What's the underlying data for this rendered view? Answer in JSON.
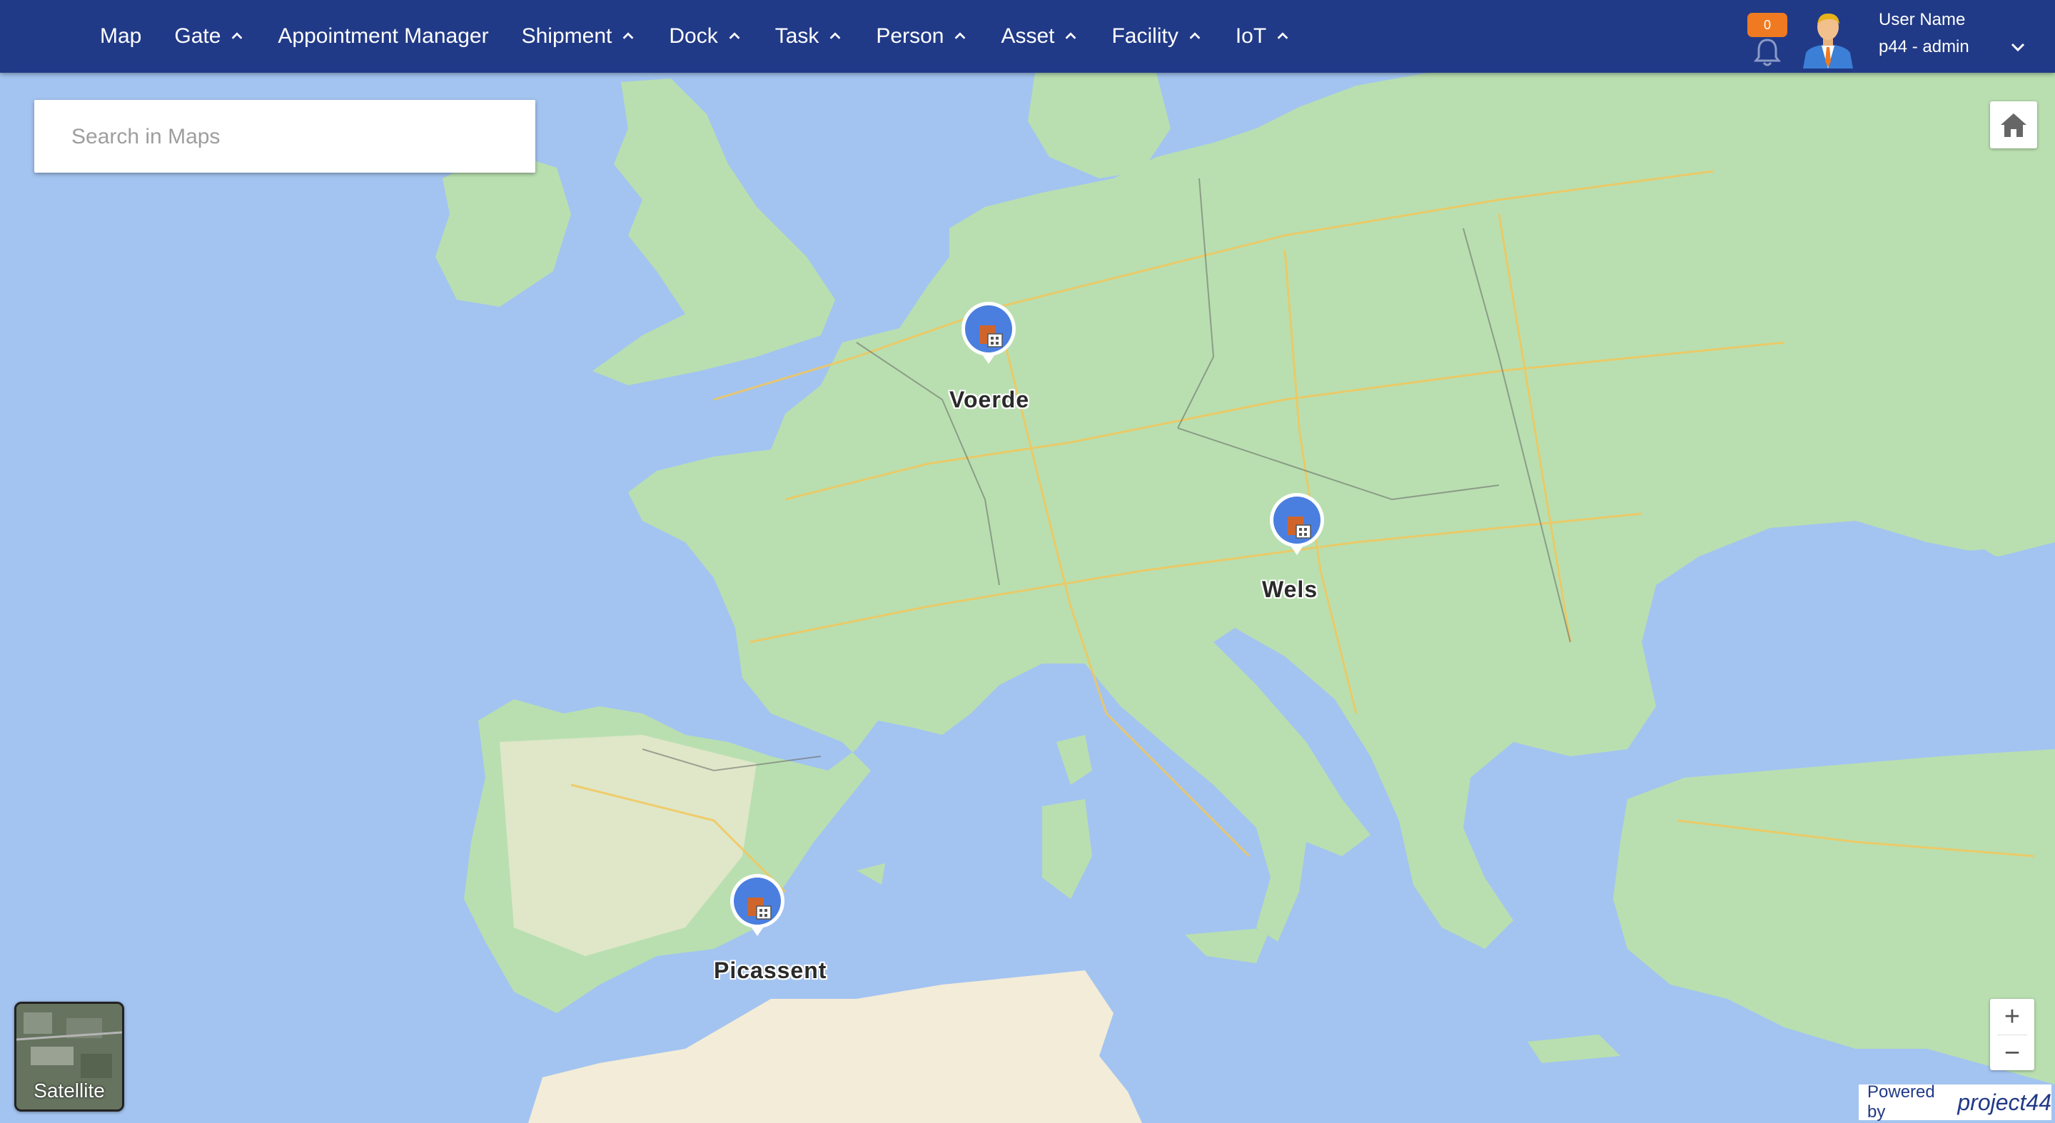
{
  "nav": {
    "items": [
      {
        "label": "Map",
        "dropdown": false
      },
      {
        "label": "Gate",
        "dropdown": true
      },
      {
        "label": "Appointment Manager",
        "dropdown": false
      },
      {
        "label": "Shipment",
        "dropdown": true
      },
      {
        "label": "Dock",
        "dropdown": true
      },
      {
        "label": "Task",
        "dropdown": true
      },
      {
        "label": "Person",
        "dropdown": true
      },
      {
        "label": "Asset",
        "dropdown": true
      },
      {
        "label": "Facility",
        "dropdown": true
      },
      {
        "label": "IoT",
        "dropdown": true
      }
    ]
  },
  "notifications": {
    "count": "0"
  },
  "user": {
    "name": "User Name",
    "role": "p44 - admin"
  },
  "search": {
    "placeholder": "Search in Maps"
  },
  "map": {
    "markers": [
      {
        "label": "Voerde"
      },
      {
        "label": "Wels"
      },
      {
        "label": "Picassent"
      }
    ],
    "satellite_label": "Satellite",
    "zoom_in": "+",
    "zoom_out": "−"
  },
  "footer": {
    "powered_by": "Powered by",
    "brand": "project44"
  },
  "colors": {
    "topbar": "#213a87",
    "water": "#a3c4f0",
    "land": "#b9dfb0",
    "marker": "#4a7fe0",
    "badge": "#ef7a22"
  },
  "icons": [
    "chevron-up-icon",
    "bell-icon",
    "avatar-icon",
    "chevron-down-icon",
    "home-icon",
    "facility-icon"
  ]
}
